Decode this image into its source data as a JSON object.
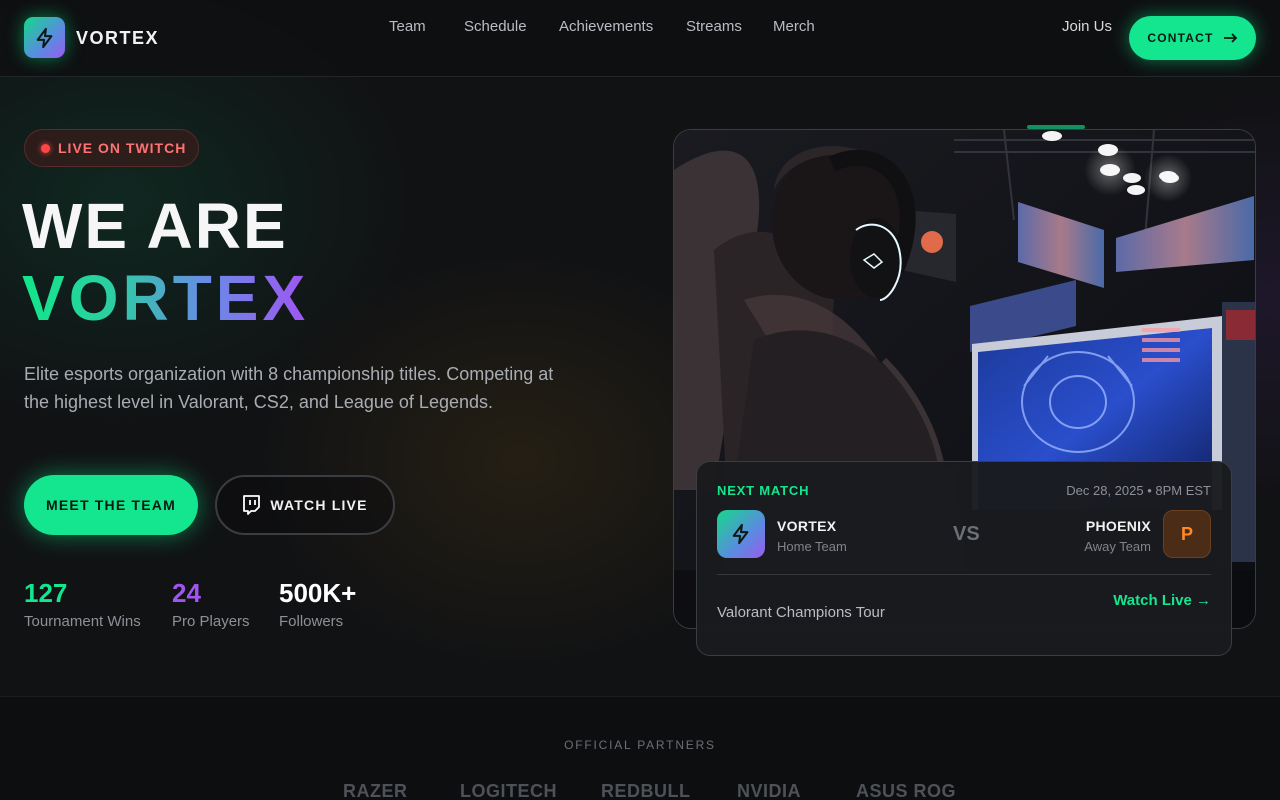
{
  "brand": {
    "name": "VORTEX",
    "logo_icon": "lightning-bolt-icon"
  },
  "nav": {
    "links": [
      "Team",
      "Schedule",
      "Achievements",
      "Streams",
      "Merch"
    ],
    "join": "Join Us",
    "contact": "CONTACT",
    "contact_icon": "arrow-right-icon"
  },
  "hero": {
    "badge": "LIVE ON TWITCH",
    "line1": "WE ARE",
    "line2": "VORTEX",
    "description": "Elite esports organization with 8 championship titles. Competing at the highest level in Valorant, CS2, and League of Legends.",
    "primary_cta": "MEET THE TEAM",
    "secondary_cta": "WATCH LIVE",
    "secondary_icon": "twitch-icon",
    "stats": [
      {
        "value": "127",
        "label": "Tournament Wins",
        "color": "#14e58f"
      },
      {
        "value": "24",
        "label": "Pro Players",
        "color": "#a055f2"
      },
      {
        "value": "500K+",
        "label": "Followers",
        "color": "#ffffff"
      }
    ]
  },
  "match": {
    "label": "NEXT MATCH",
    "date": "Dec 28, 2025 • 8PM EST",
    "home": {
      "name": "VORTEX",
      "sub": "Home Team"
    },
    "vs": "VS",
    "away": {
      "name": "PHOENIX",
      "sub": "Away Team",
      "initial": "P"
    },
    "event": "Valorant Champions Tour",
    "watch": "Watch Live →"
  },
  "partners": {
    "label": "OFFICIAL PARTNERS",
    "names": [
      "RAZER",
      "LOGITECH",
      "REDBULL",
      "NVIDIA",
      "ASUS ROG"
    ]
  },
  "colors": {
    "accent": "#14e58f",
    "purple": "#a055f2",
    "live": "#ff4545"
  }
}
